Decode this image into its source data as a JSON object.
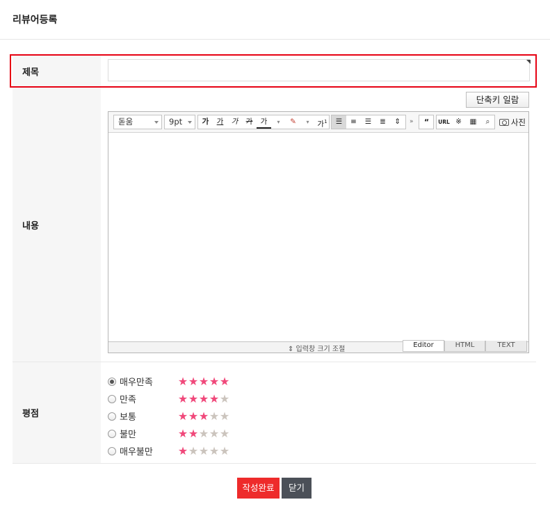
{
  "page": {
    "title": "리뷰어등록"
  },
  "form": {
    "title_label": "제목",
    "title_value": "",
    "content_label": "내용",
    "rating_label": "평점"
  },
  "editor": {
    "shortcut_button": "단축키 일람",
    "font_family": "돋움",
    "font_size": "9pt",
    "format_buttons": [
      "가",
      "가",
      "가",
      "가",
      "가"
    ],
    "superscript": "가",
    "subscript": "가",
    "quote_button": "66",
    "url_button": "URL",
    "photo_button": "사진",
    "resize_label": "⇕ 입력창 크기 조절",
    "modes": [
      "Editor",
      "HTML",
      "TEXT"
    ]
  },
  "ratings": [
    {
      "label": "매우만족",
      "stars": 5,
      "checked": true
    },
    {
      "label": "만족",
      "stars": 4,
      "checked": false
    },
    {
      "label": "보통",
      "stars": 3,
      "checked": false
    },
    {
      "label": "불만",
      "stars": 2,
      "checked": false
    },
    {
      "label": "매우불만",
      "stars": 1,
      "checked": false
    }
  ],
  "rating_max": 5,
  "buttons": {
    "submit": "작성완료",
    "close": "닫기"
  },
  "colors": {
    "star_on": "#f0487a",
    "star_off": "#cbc4bd",
    "submit": "#ee2b2b",
    "close": "#4b5058",
    "highlight": "#e60012"
  }
}
